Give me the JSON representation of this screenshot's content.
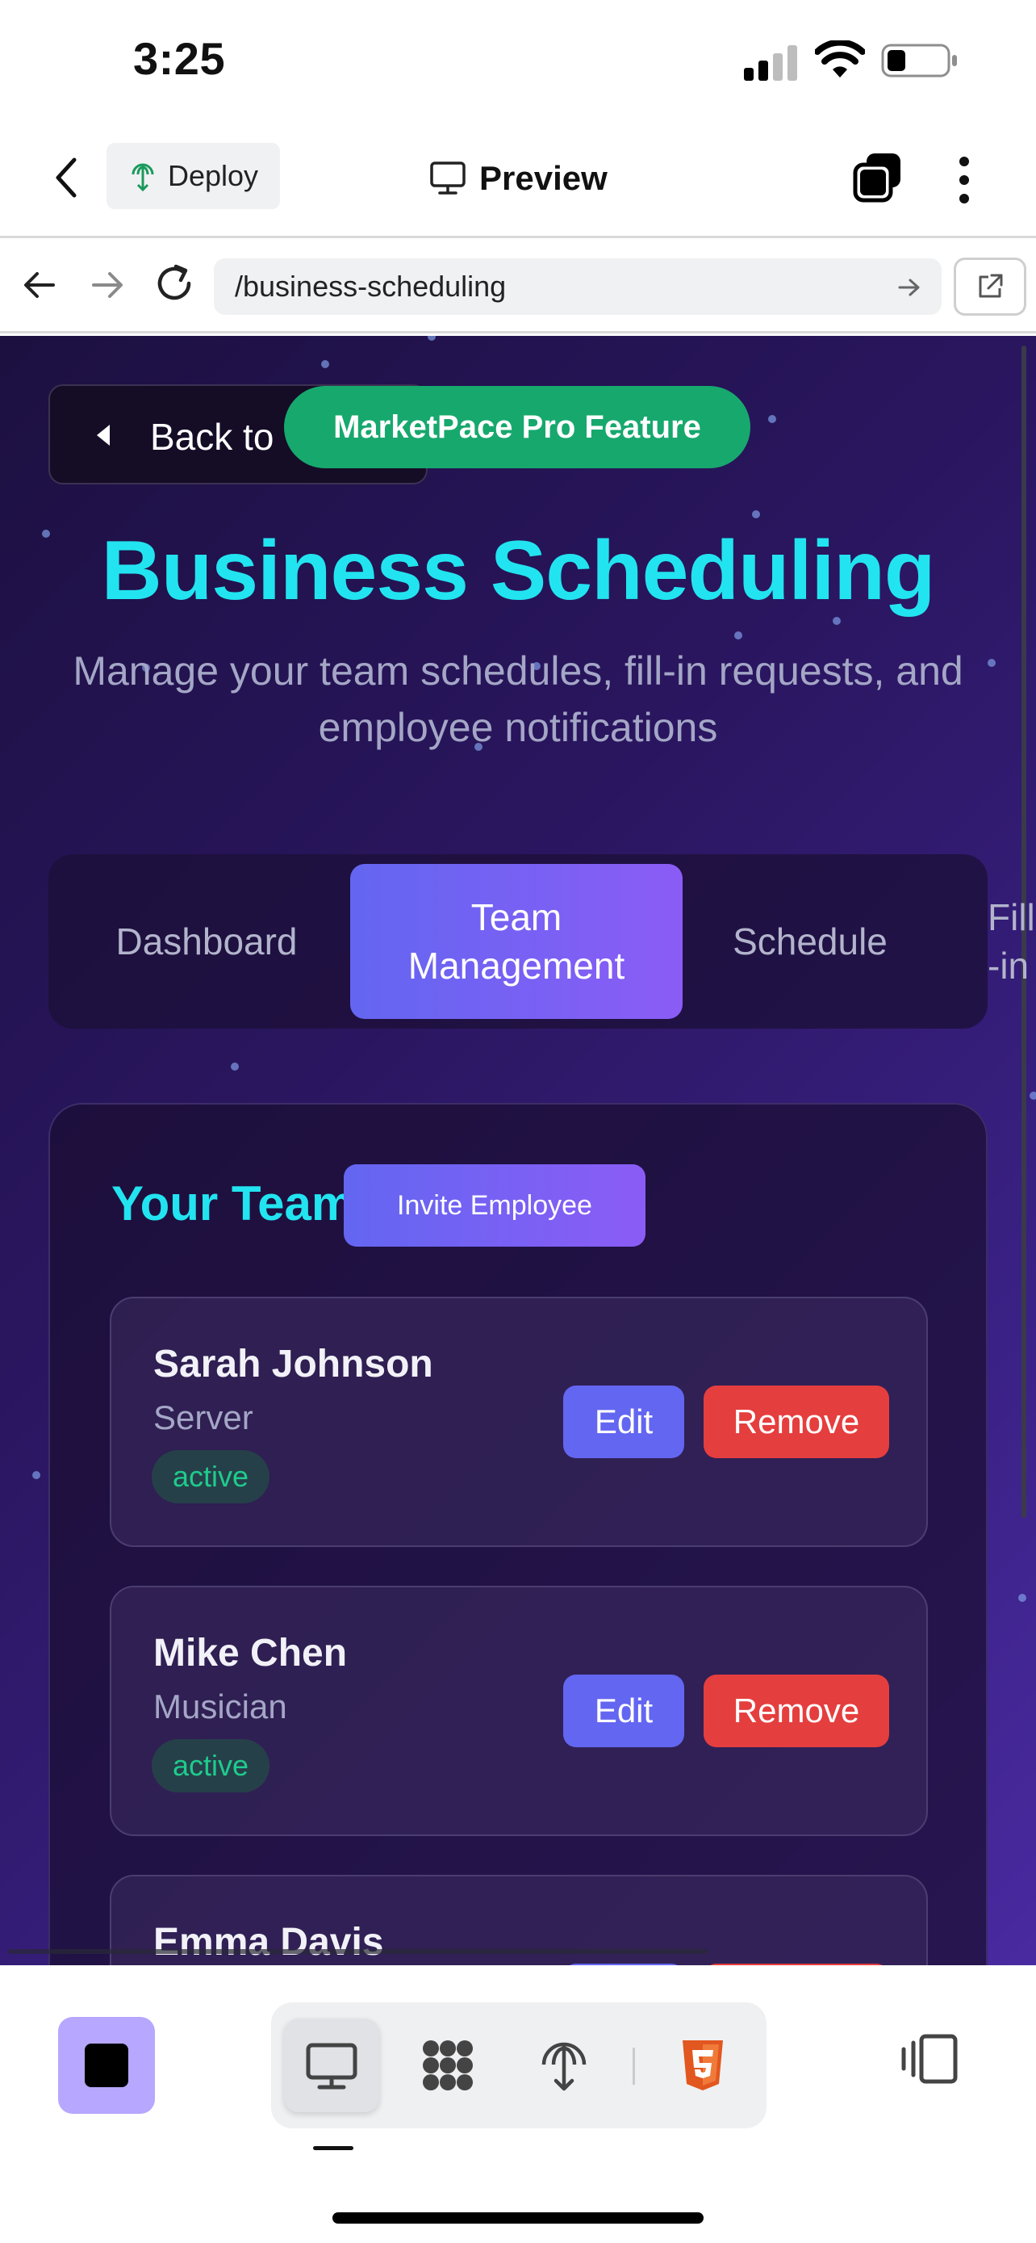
{
  "status_bar": {
    "time": "3:25"
  },
  "toolbar": {
    "deploy_label": "Deploy",
    "preview_label": "Preview"
  },
  "browser": {
    "url": "/business-scheduling"
  },
  "page": {
    "back_label": "Back to",
    "pro_badge": "MarketPace Pro Feature",
    "title": "Business Scheduling",
    "subtitle": "Manage your team schedules, fill-in requests, and employee notifications",
    "tabs": [
      {
        "label": "Dashboard",
        "active": false
      },
      {
        "label": "Team Management",
        "active": true
      },
      {
        "label": "Schedule",
        "active": false
      },
      {
        "label": "Fill-in",
        "active": false
      }
    ],
    "team": {
      "title": "Your Team",
      "invite_label": "Invite Employee",
      "edit_label": "Edit",
      "remove_label": "Remove",
      "employees": [
        {
          "name": "Sarah Johnson",
          "role": "Server",
          "status": "active"
        },
        {
          "name": "Mike Chen",
          "role": "Musician",
          "status": "active"
        },
        {
          "name": "Emma Davis",
          "role": "",
          "status": ""
        }
      ]
    }
  },
  "dock": {
    "modes": [
      "desktop-preview-icon",
      "app-grid-icon",
      "deploy-icon",
      "html5-icon"
    ],
    "active_mode": "desktop-preview-icon"
  },
  "colors": {
    "accent_cyan": "#22e4f0",
    "accent_purple": "#6366f1",
    "badge_green": "#17a86e",
    "danger_red": "#e53e3e",
    "status_green": "#1fcb8c"
  }
}
